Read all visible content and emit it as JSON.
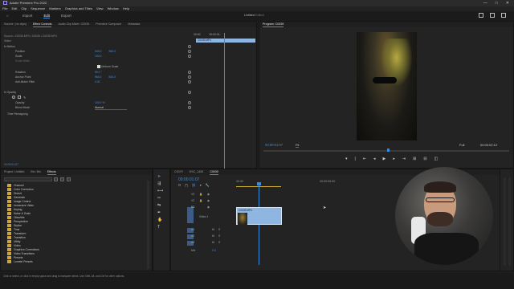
{
  "app": {
    "title": "Adobe Premiere Pro 2022"
  },
  "menu": [
    "File",
    "Edit",
    "Clip",
    "Sequence",
    "Markers",
    "Graphics and Titles",
    "View",
    "Window",
    "Help"
  ],
  "workspace": {
    "tabs": [
      "Home",
      "Import",
      "Edit",
      "Export"
    ],
    "active": "Edit",
    "project_title": "Untitled",
    "project_sub": "Edited"
  },
  "window_buttons": [
    "—",
    "□",
    "✕"
  ],
  "source_panel": {
    "tabs": [
      "Source: (no clips)",
      "Effect Controls",
      "Audio Clip Mixer: C0039",
      "Premiere Composer",
      "Metadata"
    ],
    "active": "Effect Controls",
    "breadcrumb": "Source • C0039.MP4  •  C0039 • C0039.MP4",
    "mini_timecode_a": "00:00",
    "mini_timecode_b": "00:00:01:",
    "clip_label": "C0039.MP4",
    "section_video": "Video",
    "rows": [
      {
        "label": "fx  Motion",
        "v1": "",
        "v2": ""
      },
      {
        "label": "Position",
        "v1": "540.0",
        "v2": "960.0"
      },
      {
        "label": "Scale",
        "v1": "100.0",
        "v2": ""
      },
      {
        "label": "Scale Width",
        "v1": "",
        "v2": ""
      },
      {
        "label": "",
        "v1": "Uniform Scale",
        "v2": ""
      },
      {
        "label": "Rotation",
        "v1": "90.0 °",
        "v2": ""
      },
      {
        "label": "Anchor Point",
        "v1": "960.0",
        "v2": "540.0"
      },
      {
        "label": "Anti-flicker Filter",
        "v1": "0.00",
        "v2": ""
      },
      {
        "label": "fx  Opacity",
        "v1": "",
        "v2": ""
      },
      {
        "label": "Opacity",
        "v1": "100.0 %",
        "v2": ""
      },
      {
        "label": "Blend Mode",
        "v1": "Normal",
        "v2": ""
      },
      {
        "label": "Time Remapping",
        "v1": "",
        "v2": ""
      }
    ],
    "bottom_timecode": "00:00:01:07"
  },
  "program": {
    "title": "Program: C0039",
    "timecode": "00:00:01:07",
    "fit": "Fit",
    "quality": "Full",
    "duration": "00:00:02:12"
  },
  "project_panel": {
    "tabs": [
      "Project: Untitled",
      "Bin: Bin",
      "Effects"
    ],
    "active": "Effects",
    "items": [
      "Channel",
      "Color Correction",
      "Distort",
      "Generate",
      "Image Control",
      "Immersive Video",
      "Keying",
      "Noise & Grain",
      "Obsolete",
      "Perspective",
      "Stylize",
      "Time",
      "Transform",
      "Transition",
      "Utility",
      "Video",
      "Graphics Corrections",
      "Video Transitions",
      "Presets",
      "Lumetri Presets"
    ]
  },
  "timeline": {
    "tabs": [
      "C0079",
      "DSC_1455",
      "C0039"
    ],
    "active": "C0039",
    "timecode": "00:00:01:07",
    "ruler": [
      "00:00",
      "00:00:05:00"
    ],
    "tracks": [
      "V3",
      "V2",
      "V1",
      "A1",
      "A2",
      "A3",
      "Mix"
    ],
    "video_label": "Video 1",
    "clip_label": "C0039.MP4",
    "mix_value": "0.0"
  },
  "status_text": "Click to select, or click in empty space and drag to marquee select. Use Shift, Alt, and Ctrl for other options."
}
